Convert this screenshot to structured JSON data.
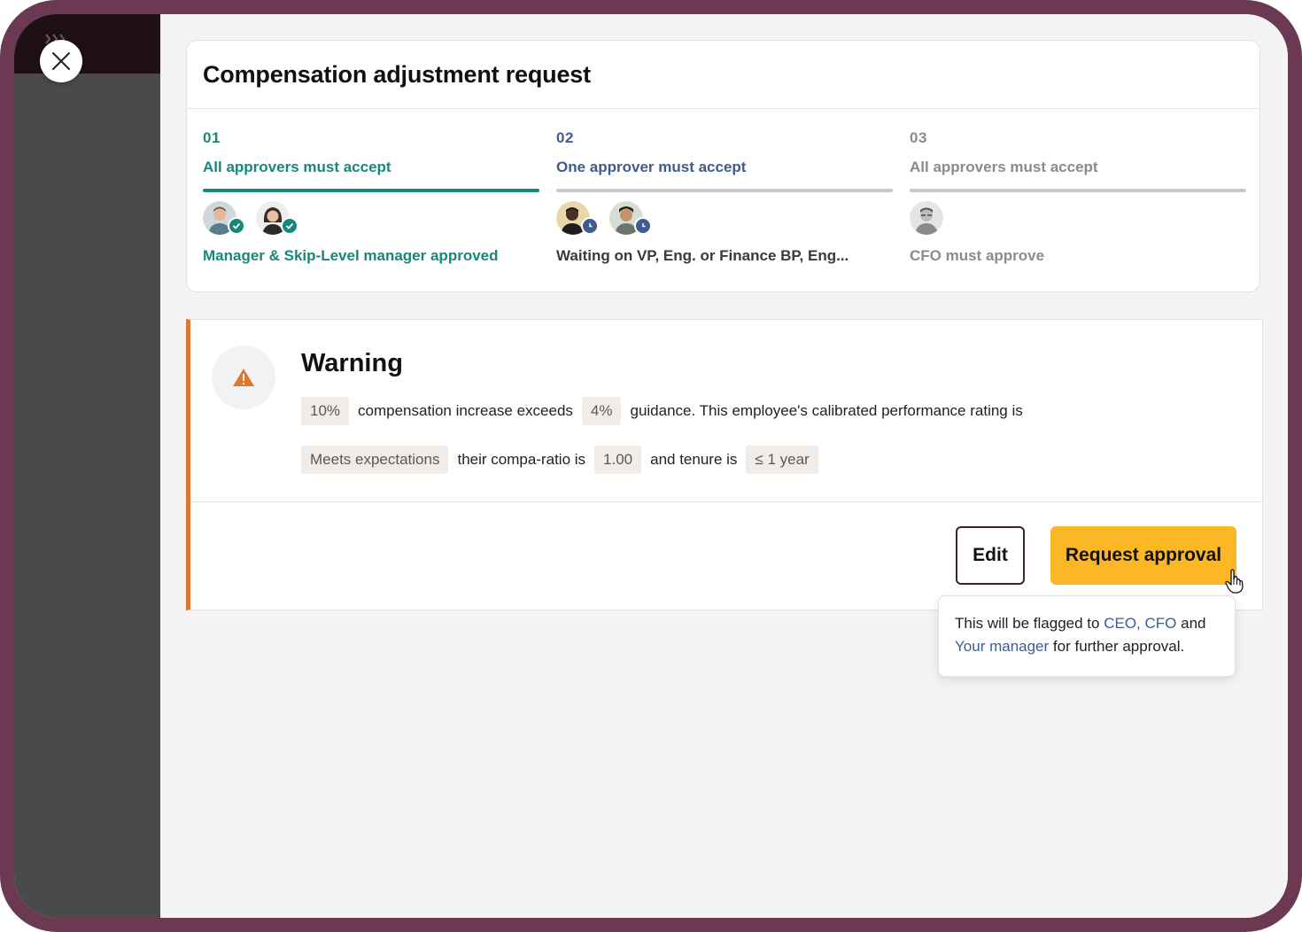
{
  "close": {
    "icon": "close-icon"
  },
  "request": {
    "title": "Compensation adjustment request",
    "steps": [
      {
        "number": "01",
        "label": "All approvers must accept",
        "status_text": "Manager & Skip-Level manager approved",
        "state": "approved",
        "color": "#16887a",
        "avatars": [
          {
            "name": "manager",
            "status_icon": "check-icon"
          },
          {
            "name": "skip-level-manager",
            "status_icon": "check-icon"
          }
        ]
      },
      {
        "number": "02",
        "label": "One approver must accept",
        "status_text": "Waiting on VP, Eng. or Finance BP, Eng...",
        "state": "waiting",
        "color": "#3e5c8e",
        "avatars": [
          {
            "name": "vp-eng",
            "status_icon": "clock-icon"
          },
          {
            "name": "finance-bp",
            "status_icon": "clock-icon"
          }
        ]
      },
      {
        "number": "03",
        "label": "All approvers must accept",
        "status_text": "CFO must approve",
        "state": "pending",
        "color": "#8b8b8b",
        "avatars": [
          {
            "name": "cfo",
            "status_icon": ""
          }
        ]
      }
    ]
  },
  "warning": {
    "icon": "warning-triangle-icon",
    "title": "Warning",
    "increase": "10%",
    "text_1": "compensation increase exceeds",
    "guidance": "4%",
    "text_2": "guidance. This employee's calibrated performance rating is",
    "rating": "Meets expectations",
    "text_3": "their compa-ratio is",
    "compa_ratio": "1.00",
    "text_4": "and tenure is",
    "tenure": "≤ 1 year",
    "accent_color": "#e0782c"
  },
  "actions": {
    "edit_label": "Edit",
    "request_label": "Request approval",
    "request_color": "#fbb824"
  },
  "tooltip": {
    "prefix": "This will be flagged to",
    "link_1": "CEO, CFO",
    "middle": "and",
    "link_2": "Your manager",
    "suffix": "for further approval."
  }
}
